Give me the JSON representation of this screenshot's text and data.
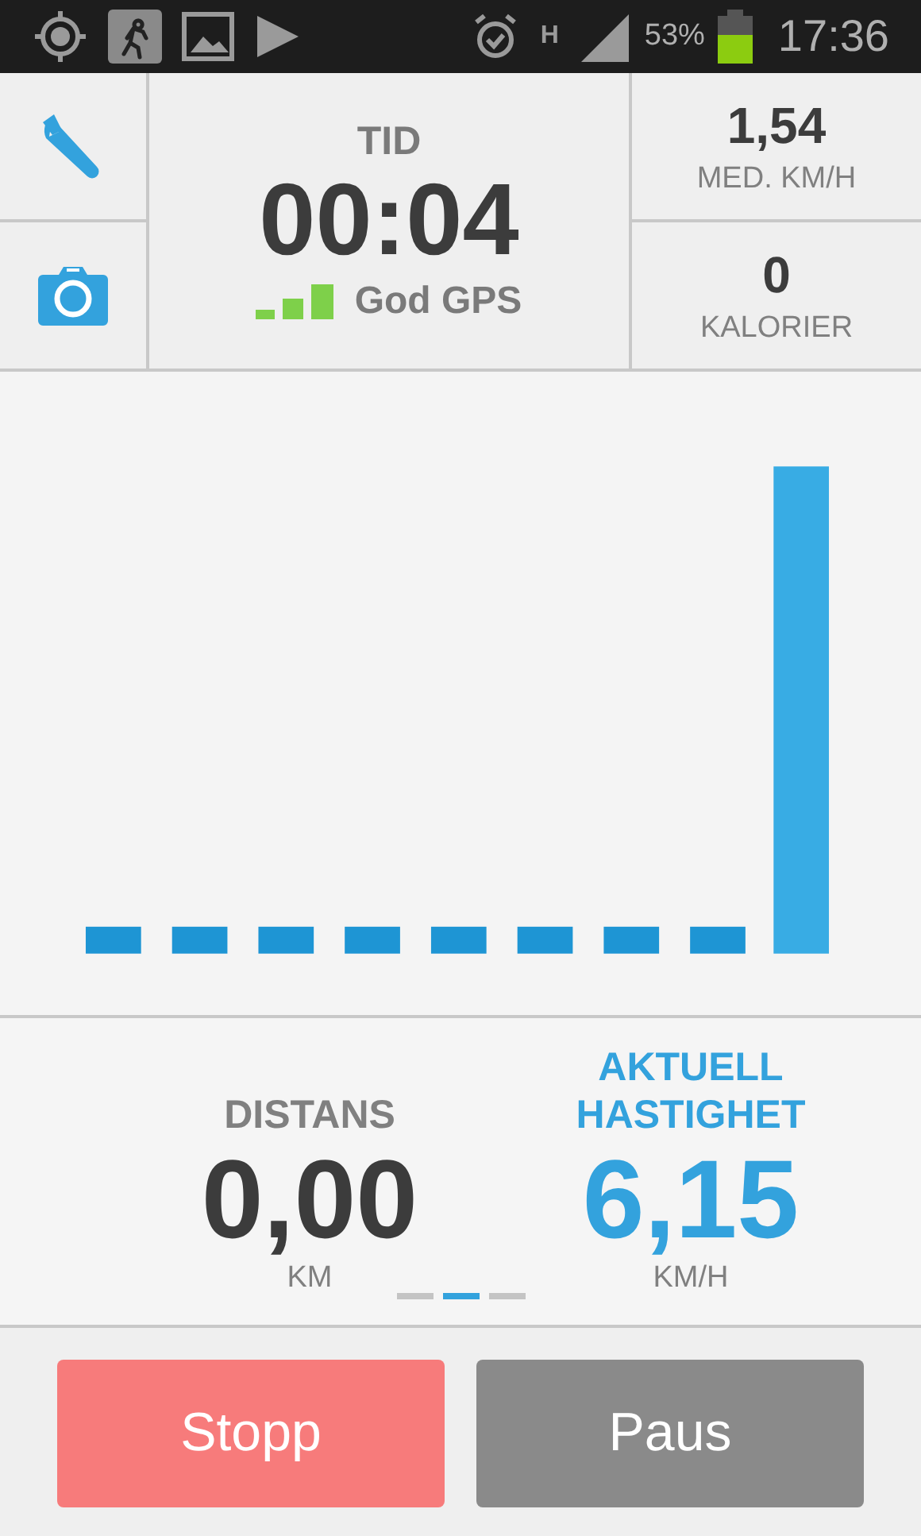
{
  "status_bar": {
    "network": "H",
    "battery": "53%",
    "time": "17:36"
  },
  "top_panel": {
    "time_label": "TID",
    "time_value": "00:04",
    "gps_label": "God GPS",
    "avg_speed": {
      "value": "1,54",
      "label": "MED. KM/H"
    },
    "calories": {
      "value": "0",
      "label": "KALORIER"
    }
  },
  "stats": [
    {
      "label": "DISTANS",
      "value": "0,00",
      "unit": "KM",
      "highlighted": false
    },
    {
      "label": "AKTUELL HASTIGHET",
      "value": "6,15",
      "unit": "KM/H",
      "highlighted": true
    }
  ],
  "pages": [
    {
      "selected": false
    },
    {
      "selected": true
    },
    {
      "selected": false
    }
  ],
  "buttons": [
    {
      "label": "Stopp",
      "kind": "stop"
    },
    {
      "label": "Paus",
      "kind": "pause"
    }
  ]
}
